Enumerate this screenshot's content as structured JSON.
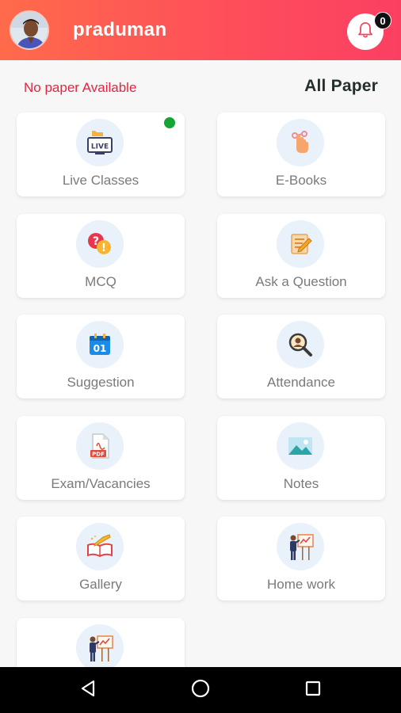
{
  "header": {
    "username": "praduman",
    "notification_count": "0"
  },
  "subheader": {
    "status_text": "No paper Available",
    "all_paper_label": "All Paper"
  },
  "menu": {
    "live_classes": "Live Classes",
    "live_badge_text": "LIVE",
    "ebooks": "E-Books",
    "mcq": "MCQ",
    "ask_question": "Ask a Question",
    "suggestion": "Suggestion",
    "suggestion_date": "01",
    "attendance": "Attendance",
    "exam_vacancies": "Exam/Vacancies",
    "pdf_label": "PDF",
    "notes": "Notes",
    "gallery": "Gallery",
    "home_work": "Home work"
  },
  "colors": {
    "header_start": "#ff6b4a",
    "header_end": "#fb3f62",
    "status_red": "#e8233f",
    "live_indicator": "#16a534"
  },
  "icons": {
    "live_classes": "live-tv-icon",
    "ebooks": "touch-book-icon",
    "mcq": "question-mark-icon",
    "ask_question": "edit-note-icon",
    "suggestion": "calendar-icon",
    "attendance": "search-person-icon",
    "exam_vacancies": "pdf-file-icon",
    "notes": "image-icon",
    "gallery": "book-pencil-icon",
    "home_work": "teacher-board-icon",
    "extra": "teacher-board-icon"
  }
}
